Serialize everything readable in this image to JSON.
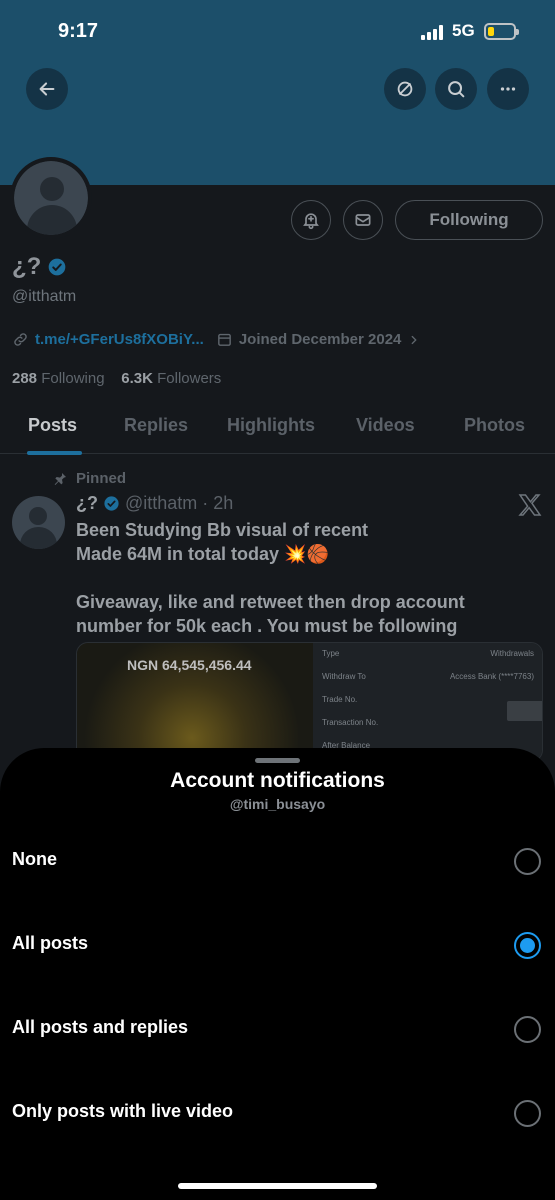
{
  "status_bar": {
    "time": "9:17",
    "network": "5G"
  },
  "profile": {
    "display_name": "¿?",
    "handle": "@itthatm",
    "link": "t.me/+GFerUs8fXOBiY...",
    "joined": "Joined December 2024",
    "following_count": "288",
    "following_label": "Following",
    "followers_count": "6.3K",
    "followers_label": "Followers",
    "follow_button": "Following"
  },
  "tabs": [
    "Posts",
    "Replies",
    "Highlights",
    "Videos",
    "Photos"
  ],
  "active_tab": "Posts",
  "post": {
    "pinned_label": "Pinned",
    "author": "¿?",
    "handle_time": "@itthatm · 2h",
    "lines": [
      "Been Studying Bb visual of recent",
      "Made 64M in total today 💥🏀",
      "",
      "Giveaway, like and retweet then drop account number for 50k each . You must be following"
    ],
    "media": {
      "amount": "NGN 64,545,456.44",
      "rows": [
        {
          "label": "Type",
          "value": "Withdrawals"
        },
        {
          "label": "Withdraw To",
          "value": "Access Bank (****7763)"
        },
        {
          "label": "Trade No.",
          "value": ""
        },
        {
          "label": "Transaction No.",
          "value": ""
        },
        {
          "label": "After Balance",
          "value": ""
        }
      ]
    }
  },
  "sheet": {
    "title": "Account notifications",
    "subtitle": "@timi_busayo",
    "options": [
      {
        "label": "None",
        "selected": false
      },
      {
        "label": "All posts",
        "selected": true
      },
      {
        "label": "All posts and replies",
        "selected": false
      },
      {
        "label": "Only posts with live video",
        "selected": false
      }
    ]
  },
  "colors": {
    "accent": "#1d9bf0",
    "banner": "#1c4f6a",
    "sheet_bg": "#000000"
  }
}
